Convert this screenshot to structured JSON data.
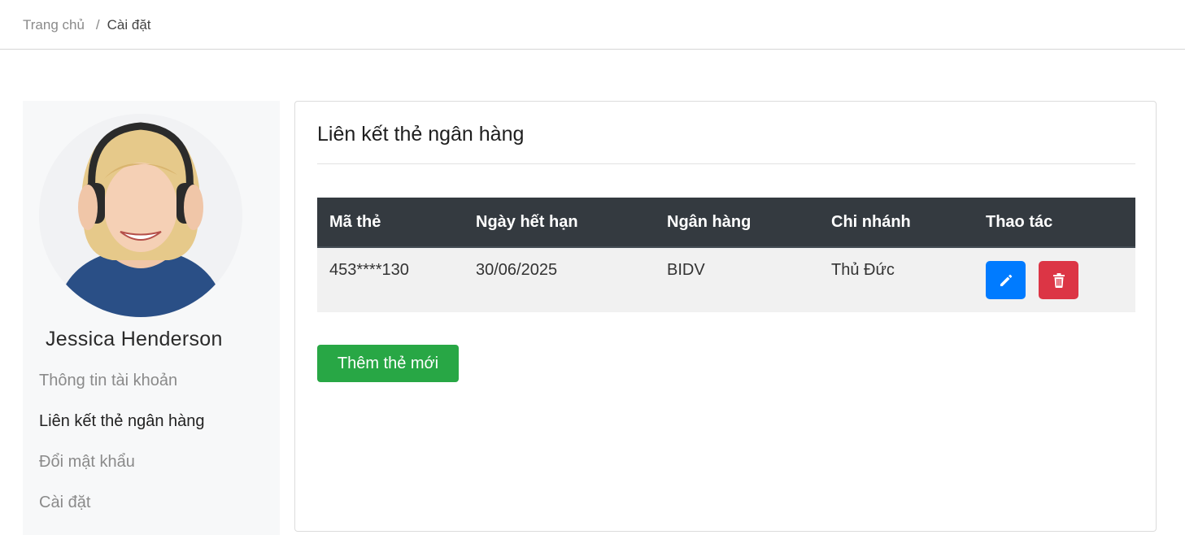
{
  "breadcrumb": {
    "home": "Trang chủ",
    "separator": "/",
    "current": "Cài đặt"
  },
  "sidebar": {
    "user_name": "Jessica Henderson",
    "items": [
      {
        "label": "Thông tin tài khoản"
      },
      {
        "label": "Liên kết thẻ ngân hàng"
      },
      {
        "label": "Đổi mật khẩu"
      },
      {
        "label": "Cài đặt"
      }
    ]
  },
  "panel": {
    "title": "Liên kết thẻ ngân hàng",
    "table": {
      "headers": [
        "Mã thẻ",
        "Ngày hết hạn",
        "Ngân hàng",
        "Chi nhánh",
        "Thao tác"
      ],
      "rows": [
        {
          "card_number": "453****130",
          "expiry": "30/06/2025",
          "bank": "BIDV",
          "branch": "Thủ Đức"
        }
      ]
    },
    "add_button": "Thêm thẻ mới"
  },
  "icons": {
    "edit": "pencil-icon",
    "delete": "trash-icon"
  },
  "colors": {
    "edit": "#007bff",
    "delete": "#dc3545",
    "add": "#28a745",
    "table_header": "#343a40"
  }
}
